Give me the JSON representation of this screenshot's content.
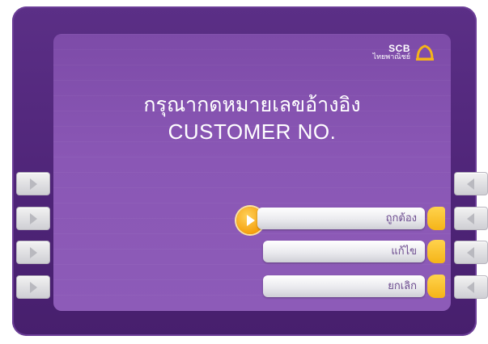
{
  "brand": {
    "name": "SCB",
    "subtitle": "ไทยพาณิชย์",
    "logo_icon": "scb-bell-logo-icon",
    "logo_color": "#f5b418"
  },
  "prompt": {
    "thai": "กรุณากดหมายเลขอ้างอิง",
    "english": "CUSTOMER NO."
  },
  "options": [
    {
      "label": "ถูกต้อง",
      "selected": true
    },
    {
      "label": "แก้ไข",
      "selected": false
    },
    {
      "label": "ยกเลิก",
      "selected": false
    }
  ],
  "colors": {
    "frame": "#4e2477",
    "screen": "#8a57b5",
    "accent": "#f5b418"
  }
}
